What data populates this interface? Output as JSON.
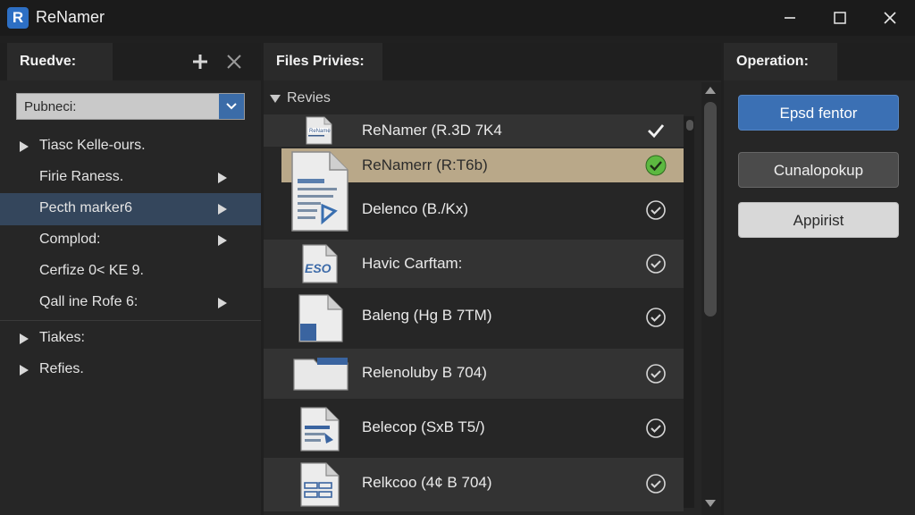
{
  "app": {
    "title": "ReNamer",
    "logo_letter": "R"
  },
  "left_panel": {
    "tab_label": "Ruedve:",
    "dropdown_value": "Pubneci:",
    "tree": [
      {
        "label": "Tiasc Kelle-ours.",
        "arrow": "expand-left"
      },
      {
        "label": "Firie Raness.",
        "arrow": "submenu"
      },
      {
        "label": "Pecth marker6",
        "arrow": "submenu",
        "selected": true
      },
      {
        "label": "Complod:",
        "arrow": "submenu"
      },
      {
        "label": "Cerfize 0< KE 9.",
        "arrow": "none"
      },
      {
        "label": "Qall ine Rofe 6:",
        "arrow": "submenu"
      },
      {
        "label": "Tiakes:",
        "arrow": "expand-left"
      },
      {
        "label": "Refies.",
        "arrow": "expand-left"
      }
    ]
  },
  "middle_panel": {
    "tab_label": "Files Privies:",
    "group_label": "Revies",
    "files": [
      {
        "name": "ReNamer (R.3D 7K4",
        "icon": "document-small-icon",
        "check": "plain"
      },
      {
        "name": "ReNamerr (R:T6b)",
        "icon": "document-large-icon",
        "check": "filled",
        "highlight": true
      },
      {
        "name": "Delenco (B./Kx)",
        "icon": "document-large-icon",
        "check": "outline"
      },
      {
        "name": "Havic Carftam:",
        "icon": "eso-file-icon",
        "check": "outline"
      },
      {
        "name": "Baleng (Hg B 7TM)",
        "icon": "document-blue-icon",
        "check": "outline"
      },
      {
        "name": "Relenoluby B 704)",
        "icon": "folder-icon",
        "check": "outline"
      },
      {
        "name": "Belecop (SxB T5/)",
        "icon": "document-form-icon",
        "check": "outline"
      },
      {
        "name": "Relkcoo (4¢ B 704)",
        "icon": "document-form-icon",
        "check": "outline"
      }
    ]
  },
  "right_panel": {
    "tab_label": "Operation:",
    "buttons": [
      "Epsd fentor",
      "Cunalopokup",
      "Appirist"
    ]
  },
  "colors": {
    "accent": "#3b70b4",
    "selected_row": "#34465c",
    "highlight_row": "#b9a889",
    "check_green": "#5cb840"
  }
}
